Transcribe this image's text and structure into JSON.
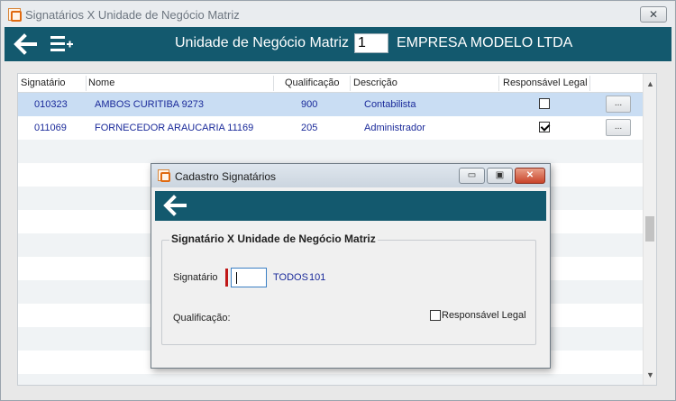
{
  "main_window": {
    "title": "Signatários X Unidade de Negócio Matriz",
    "close_glyph": "✕"
  },
  "toolbar": {
    "back_icon": "arrow-left-icon",
    "add_icon": "list-add-icon",
    "label": "Unidade de Negócio Matriz",
    "unit_value": "1",
    "company": "EMPRESA MODELO LTDA"
  },
  "grid": {
    "columns": [
      "Signatário",
      "Nome",
      "Qualificação",
      "Descrição",
      "Responsável Legal"
    ],
    "rows": [
      {
        "signatario": "010323",
        "nome": "AMBOS CURITIBA 9273",
        "qualificacao": "900",
        "descricao": "Contabilista",
        "responsavel": false,
        "button": "..."
      },
      {
        "signatario": "011069",
        "nome": "FORNECEDOR ARAUCARIA 11169",
        "qualificacao": "205",
        "descricao": "Administrador",
        "responsavel": true,
        "button": "..."
      }
    ]
  },
  "dialog": {
    "title": "Cadastro Signatários",
    "min_glyph": "▭",
    "max_glyph": "▣",
    "close_glyph": "✕",
    "group_title": "Signatário X Unidade de Negócio Matriz",
    "signatario_label": "Signatário",
    "signatario_value": "",
    "signatario_name": "TODOS",
    "signatario_code": "101",
    "qualificacao_label": "Qualificação:",
    "responsavel_label": "Responsável Legal",
    "responsavel_checked": false
  },
  "colors": {
    "toolbar_bg": "#13596e",
    "selected_row": "#c9ddf3",
    "link_text": "#1a2a9a"
  }
}
